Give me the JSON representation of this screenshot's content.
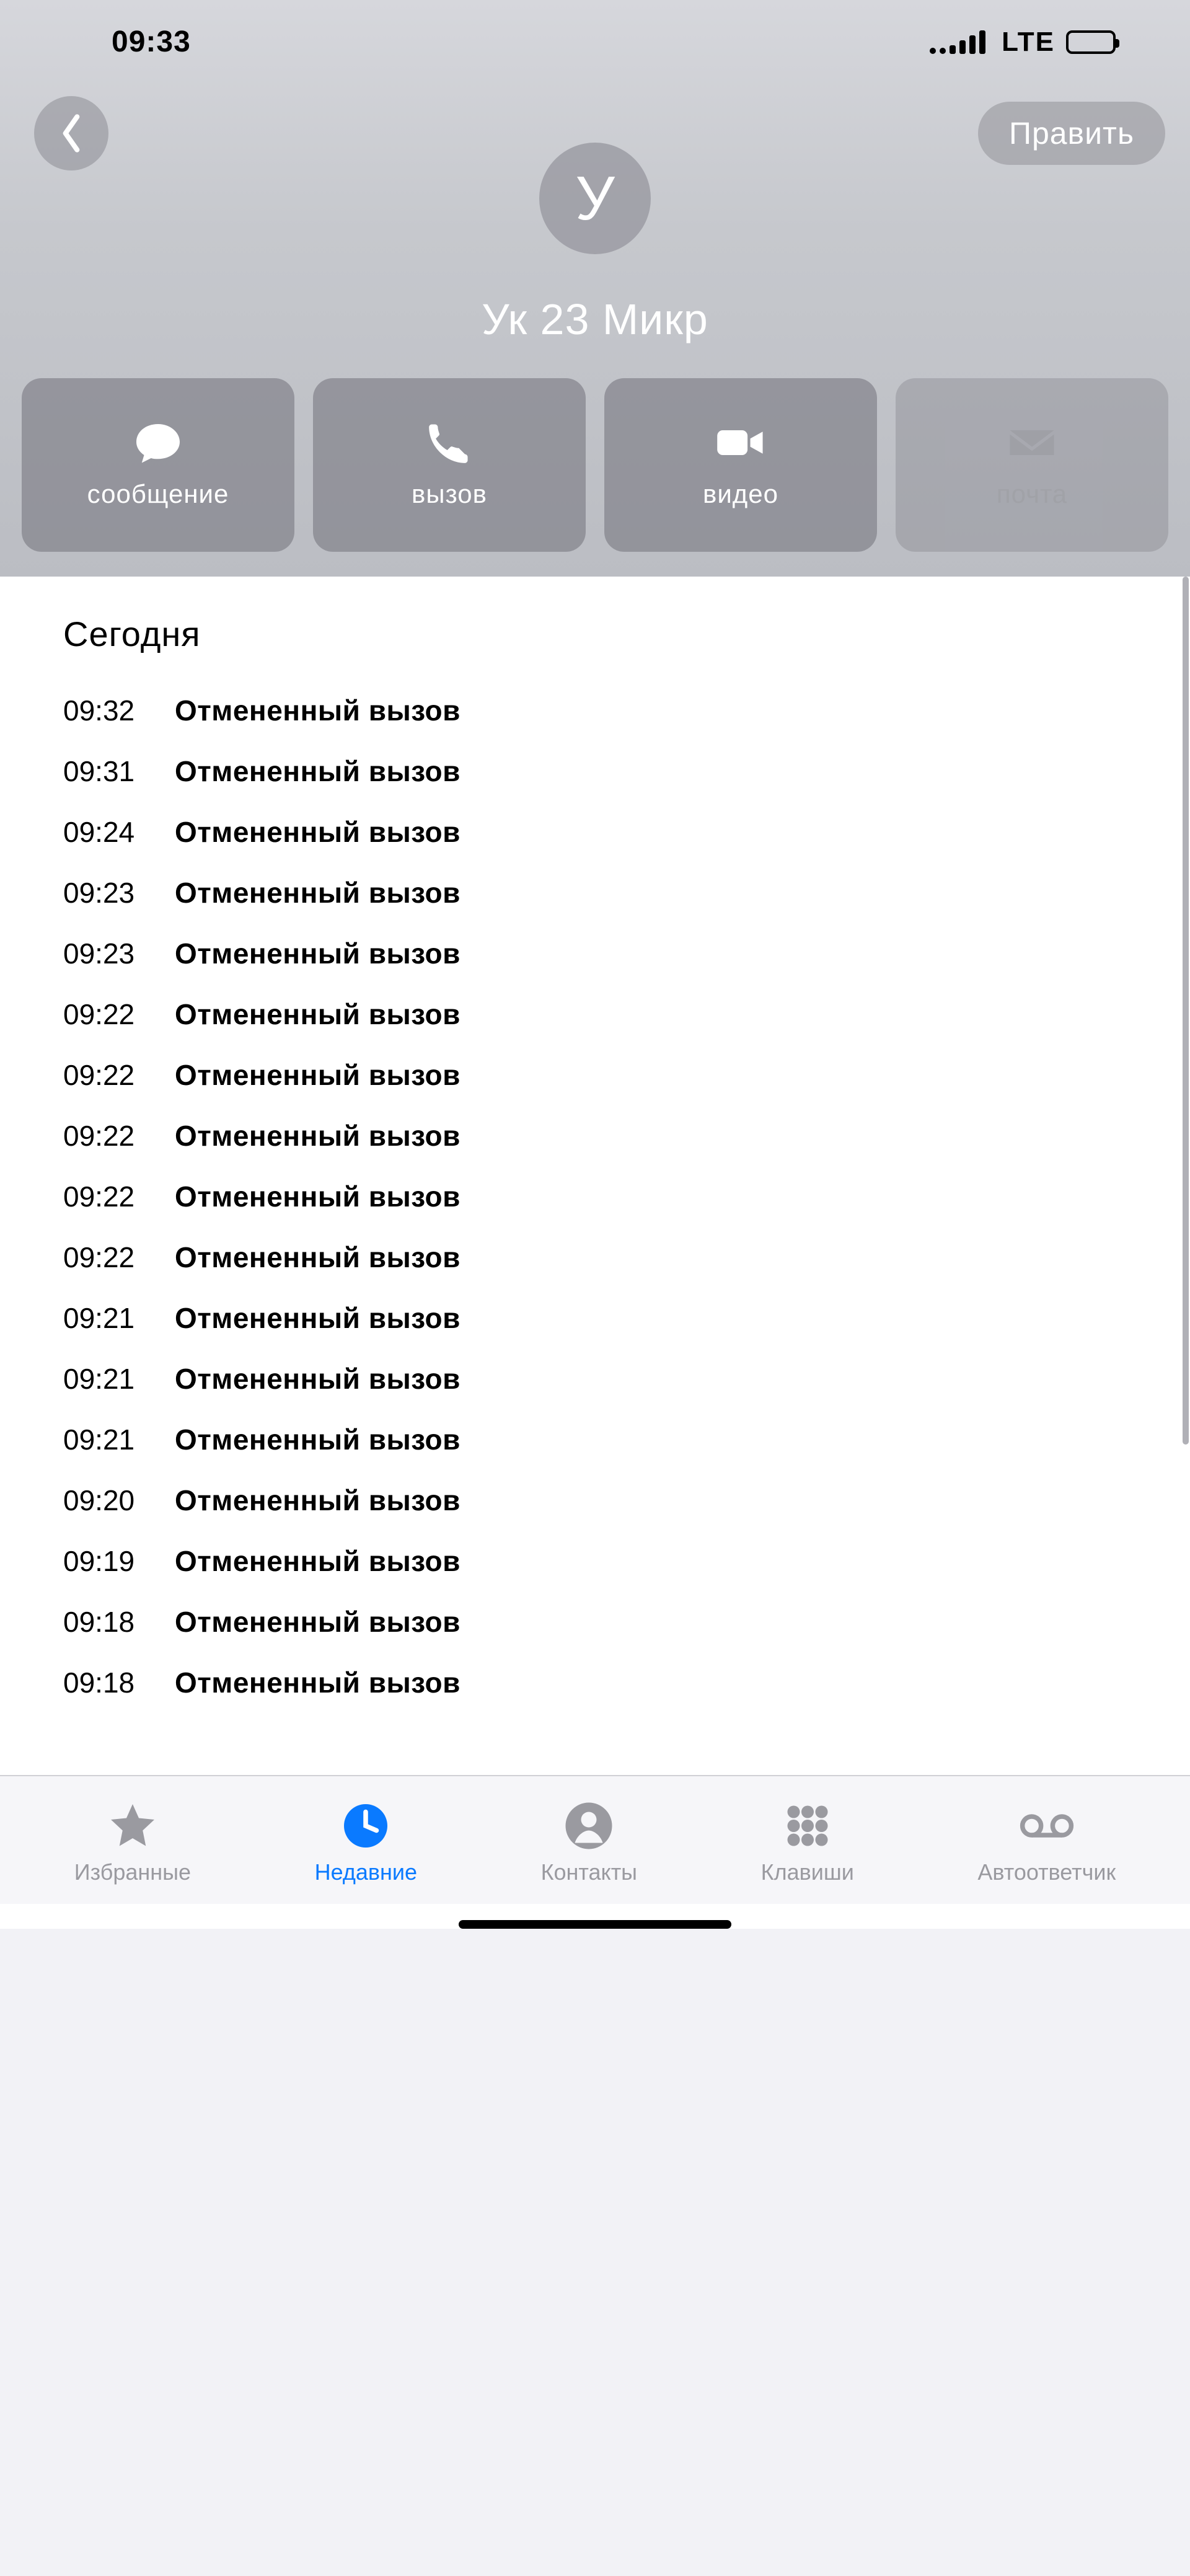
{
  "status": {
    "time": "09:33",
    "network": "LTE"
  },
  "header": {
    "edit_label": "Править",
    "avatar_initial": "У",
    "contact_name": "Ук 23 Микр"
  },
  "actions": {
    "message": "сообщение",
    "call": "вызов",
    "video": "видео",
    "mail": "почта"
  },
  "log": {
    "section_title": "Сегодня",
    "entries": [
      {
        "time": "09:32",
        "type": "Отмененный вызов"
      },
      {
        "time": "09:31",
        "type": "Отмененный вызов"
      },
      {
        "time": "09:24",
        "type": "Отмененный вызов"
      },
      {
        "time": "09:23",
        "type": "Отмененный вызов"
      },
      {
        "time": "09:23",
        "type": "Отмененный вызов"
      },
      {
        "time": "09:22",
        "type": "Отмененный вызов"
      },
      {
        "time": "09:22",
        "type": "Отмененный вызов"
      },
      {
        "time": "09:22",
        "type": "Отмененный вызов"
      },
      {
        "time": "09:22",
        "type": "Отмененный вызов"
      },
      {
        "time": "09:22",
        "type": "Отмененный вызов"
      },
      {
        "time": "09:21",
        "type": "Отмененный вызов"
      },
      {
        "time": "09:21",
        "type": "Отмененный вызов"
      },
      {
        "time": "09:21",
        "type": "Отмененный вызов"
      },
      {
        "time": "09:20",
        "type": "Отмененный вызов"
      },
      {
        "time": "09:19",
        "type": "Отмененный вызов"
      },
      {
        "time": "09:18",
        "type": "Отмененный вызов"
      },
      {
        "time": "09:18",
        "type": "Отмененный вызов"
      }
    ]
  },
  "tabs": {
    "favorites": "Избранные",
    "recents": "Недавние",
    "contacts": "Контакты",
    "keypad": "Клавиши",
    "voicemail": "Автоответчик"
  }
}
